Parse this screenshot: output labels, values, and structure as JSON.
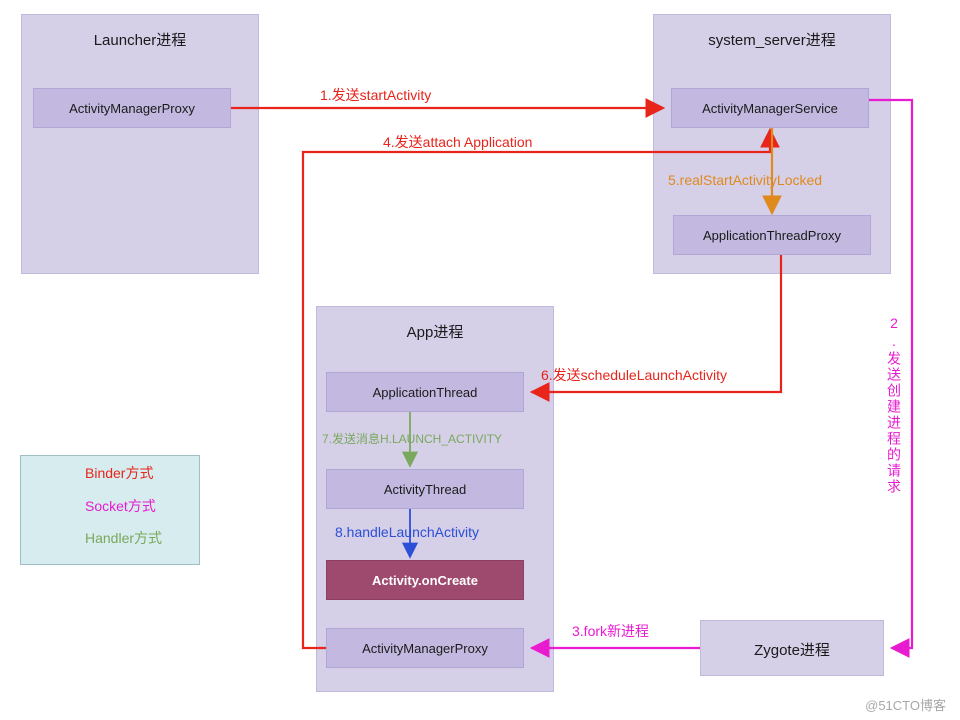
{
  "processes": [
    {
      "id": "launcher",
      "title": "Launcher进程"
    },
    {
      "id": "system_server",
      "title": "system_server进程"
    },
    {
      "id": "app",
      "title": "App进程"
    },
    {
      "id": "zygote",
      "title": "Zygote进程"
    }
  ],
  "nodes": {
    "launcher_amp": "ActivityManagerProxy",
    "ams": "ActivityManagerService",
    "atp": "ApplicationThreadProxy",
    "app_thread": "ApplicationThread",
    "activity_thread": "ActivityThread",
    "activity_oncreate": "Activity.onCreate",
    "app_amp": "ActivityManagerProxy"
  },
  "steps": {
    "s1": "1.发送startActivity",
    "s2": "2.发送创建进程的请求",
    "s3": "3.fork新进程",
    "s4": "4.发送attach Application",
    "s5": "5.realStartActivityLocked",
    "s6": "6.发送scheduleLaunchActivity",
    "s7": "7.发送消息H.LAUNCH_ACTIVITY",
    "s8": "8.handleLaunchActivity"
  },
  "legend": {
    "items": [
      {
        "label": "Binder方式",
        "color": "#e8241b"
      },
      {
        "label": "Socket方式",
        "color": "#e81bd0"
      },
      {
        "label": "Handler方式",
        "color": "#7aa85c"
      }
    ]
  },
  "watermark": "@51CTO博客",
  "colors": {
    "binder": "#e8241b",
    "socket": "#e81bd0",
    "handler": "#7aa85c",
    "orange": "#e08a1e",
    "blue": "#2b4fd6",
    "process_bg": "#d5cfe8",
    "node_bg": "#c3b9e0",
    "highlight_bg": "#9e4a6e",
    "legend_bg": "#d6ecee"
  }
}
